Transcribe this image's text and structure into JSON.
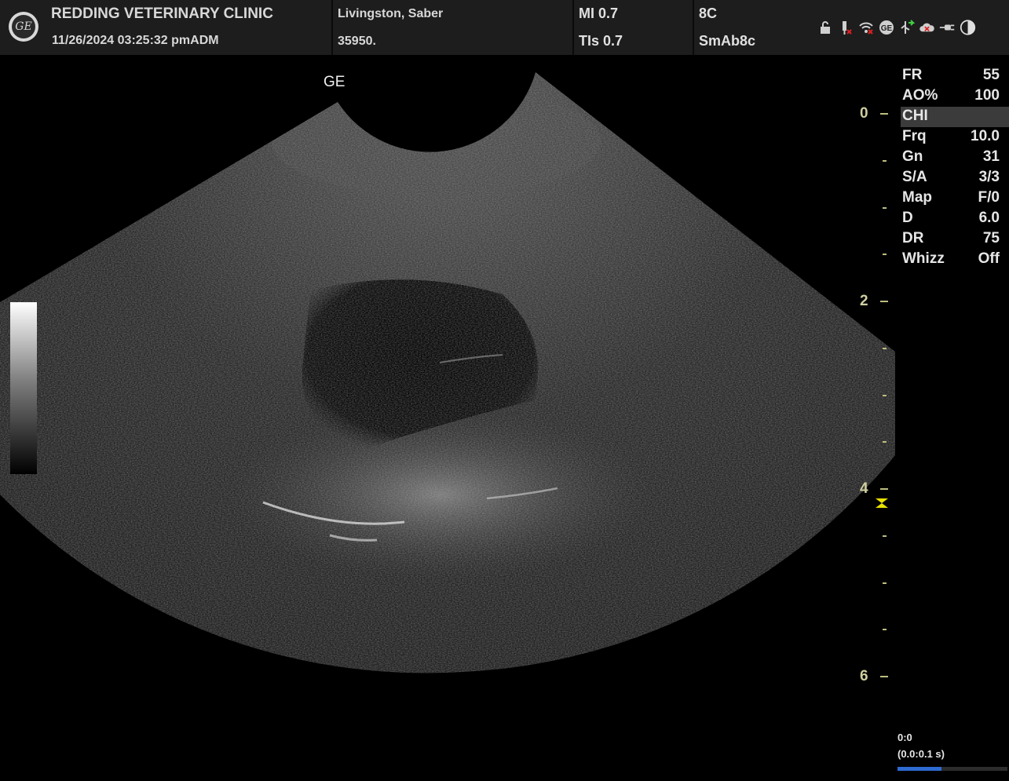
{
  "header": {
    "clinic_name": "REDDING VETERINARY CLINIC",
    "datetime": "11/26/2024 03:25:32 pm",
    "operator": "ADM",
    "patient_name": "Livingston, Saber",
    "patient_id": "35950.",
    "mi": "MI 0.7",
    "tis": "TIs 0.7",
    "probe": "8C",
    "preset": "SmAb8c",
    "logo_text": "GE",
    "status_icons": [
      "lock-icon",
      "usb-disconnected-icon",
      "wifi-icon",
      "ge-service-icon",
      "network-icon",
      "cloud-disconnected-icon",
      "power-plug-icon",
      "contrast-icon"
    ]
  },
  "image": {
    "vendor_mark": "GE"
  },
  "parameters": [
    {
      "key": "FR",
      "value": "55"
    },
    {
      "key": "AO%",
      "value": "100"
    },
    {
      "key": "CHI",
      "value": ""
    },
    {
      "key": "Frq",
      "value": "10.0"
    },
    {
      "key": "Gn",
      "value": "31"
    },
    {
      "key": "S/A",
      "value": "3/3"
    },
    {
      "key": "Map",
      "value": "F/0"
    },
    {
      "key": "D",
      "value": "6.0"
    },
    {
      "key": "DR",
      "value": "75"
    },
    {
      "key": "Whizz",
      "value": "Off"
    }
  ],
  "depth_scale": {
    "labels": [
      "0",
      "2",
      "4",
      "6"
    ],
    "max_cm": 6.0,
    "focus_depth_cm": 4.2
  },
  "cine": {
    "frame": "0:0",
    "time": "(0.0:0.1 s)",
    "progress": 0.4
  },
  "colors": {
    "accent_yellow": "#e8e000",
    "scale_color": "#cfcfa0",
    "cine_blue": "#2e6ad1"
  }
}
